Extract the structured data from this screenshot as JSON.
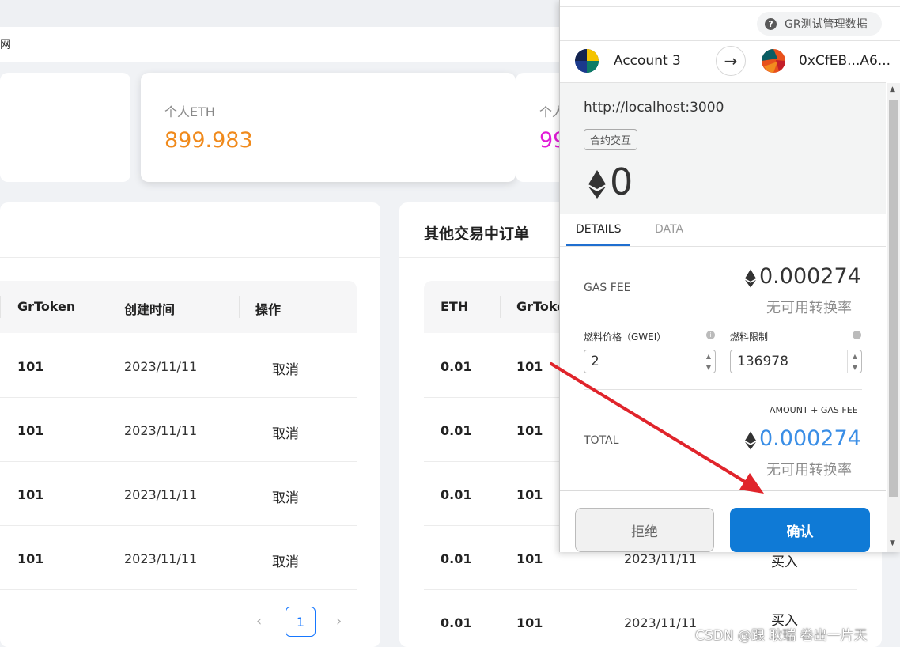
{
  "dapp": {
    "nav_fragment": "网",
    "stats": [
      {
        "label": "个人ETH",
        "value": "899.983",
        "color": "#f08a1c"
      },
      {
        "label": "个人",
        "value": "99",
        "color": "#e21bd8"
      }
    ],
    "my_orders": {
      "columns": [
        "GrToken",
        "创建时间",
        "操作"
      ],
      "rows": [
        {
          "grtoken": "101",
          "time": "2023/11/11",
          "action": "取消"
        },
        {
          "grtoken": "101",
          "time": "2023/11/11",
          "action": "取消"
        },
        {
          "grtoken": "101",
          "time": "2023/11/11",
          "action": "取消"
        },
        {
          "grtoken": "101",
          "time": "2023/11/11",
          "action": "取消"
        }
      ],
      "pagination": {
        "prev": "‹",
        "page": "1",
        "next": "›"
      }
    },
    "other_orders": {
      "title": "其他交易中订单",
      "columns": [
        "ETH",
        "GrToke"
      ],
      "rows": [
        {
          "eth": "0.01",
          "grtoken": "101",
          "time": "",
          "action": ""
        },
        {
          "eth": "0.01",
          "grtoken": "101",
          "time": "",
          "action": ""
        },
        {
          "eth": "0.01",
          "grtoken": "101",
          "time": "",
          "action": ""
        },
        {
          "eth": "0.01",
          "grtoken": "101",
          "time": "2023/11/11",
          "action": "买入"
        },
        {
          "eth": "0.01",
          "grtoken": "101",
          "time": "2023/11/11",
          "action": "买入"
        }
      ]
    },
    "watermark": "CSDN @跟 耿瑞 卷出一片天"
  },
  "metamask": {
    "network": "GR测试管理数据",
    "from_account": "Account 3",
    "to_address": "0xCfEB...A6...",
    "origin": "http://localhost:3000",
    "tag": "合约交互",
    "value": "0",
    "tabs": {
      "details": "DETAILS",
      "data": "DATA"
    },
    "gas_fee": {
      "label": "GAS FEE",
      "amount": "0.000274",
      "fiat": "无可用转换率"
    },
    "gas_price": {
      "label": "燃料价格（GWEI）",
      "value": "2"
    },
    "gas_limit": {
      "label": "燃料限制",
      "value": "136978"
    },
    "total": {
      "sublabel": "AMOUNT + GAS FEE",
      "label": "TOTAL",
      "amount": "0.000274",
      "fiat": "无可用转换率"
    },
    "buttons": {
      "reject": "拒绝",
      "confirm": "确认"
    },
    "annotation_arrow_color": "#e0242b"
  }
}
